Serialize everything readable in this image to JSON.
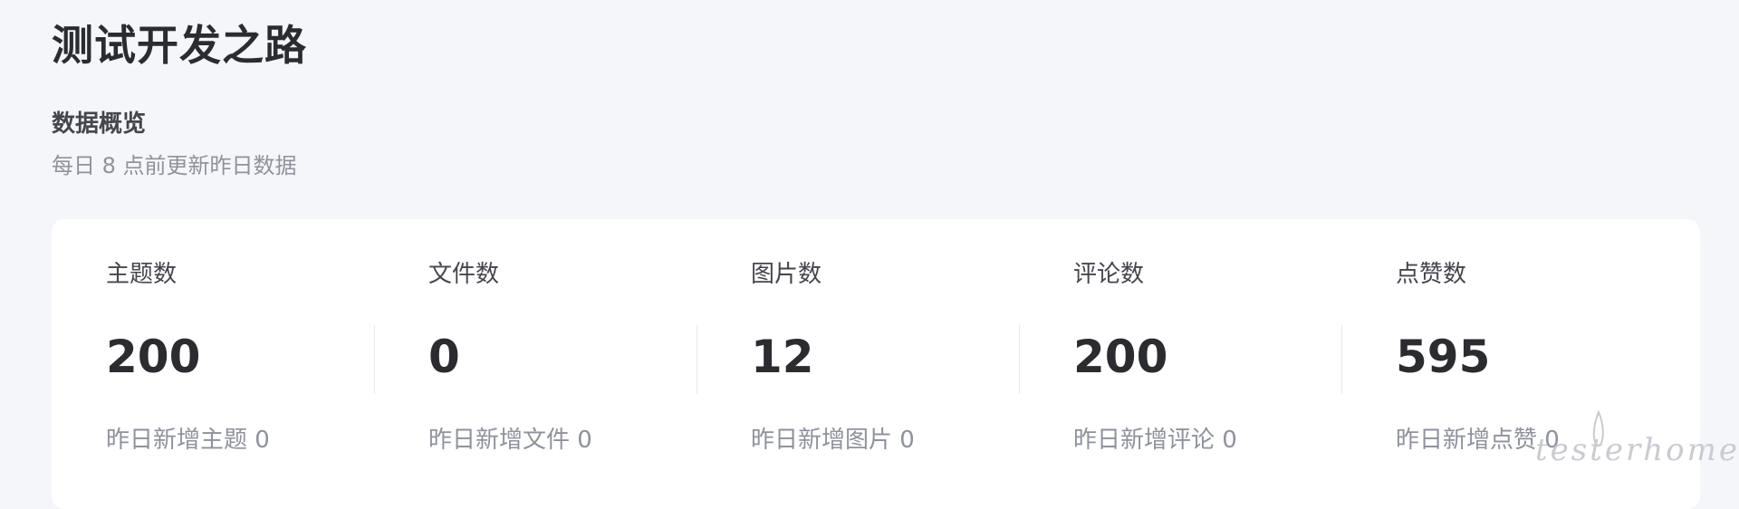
{
  "page": {
    "title": "测试开发之路"
  },
  "overview": {
    "title": "数据概览",
    "subtitle": "每日 8 点前更新昨日数据"
  },
  "stats": [
    {
      "label": "主题数",
      "value": "200",
      "delta": "昨日新增主题 0"
    },
    {
      "label": "文件数",
      "value": "0",
      "delta": "昨日新增文件 0"
    },
    {
      "label": "图片数",
      "value": "12",
      "delta": "昨日新增图片 0"
    },
    {
      "label": "评论数",
      "value": "200",
      "delta": "昨日新增评论 0"
    },
    {
      "label": "点赞数",
      "value": "595",
      "delta": "昨日新增点赞 0"
    }
  ],
  "watermark": {
    "text": "testerhome.com"
  },
  "colors": {
    "background": "#f5f6fa",
    "card": "#ffffff",
    "title": "#2b2c30",
    "secondary_text": "#8f929c"
  }
}
